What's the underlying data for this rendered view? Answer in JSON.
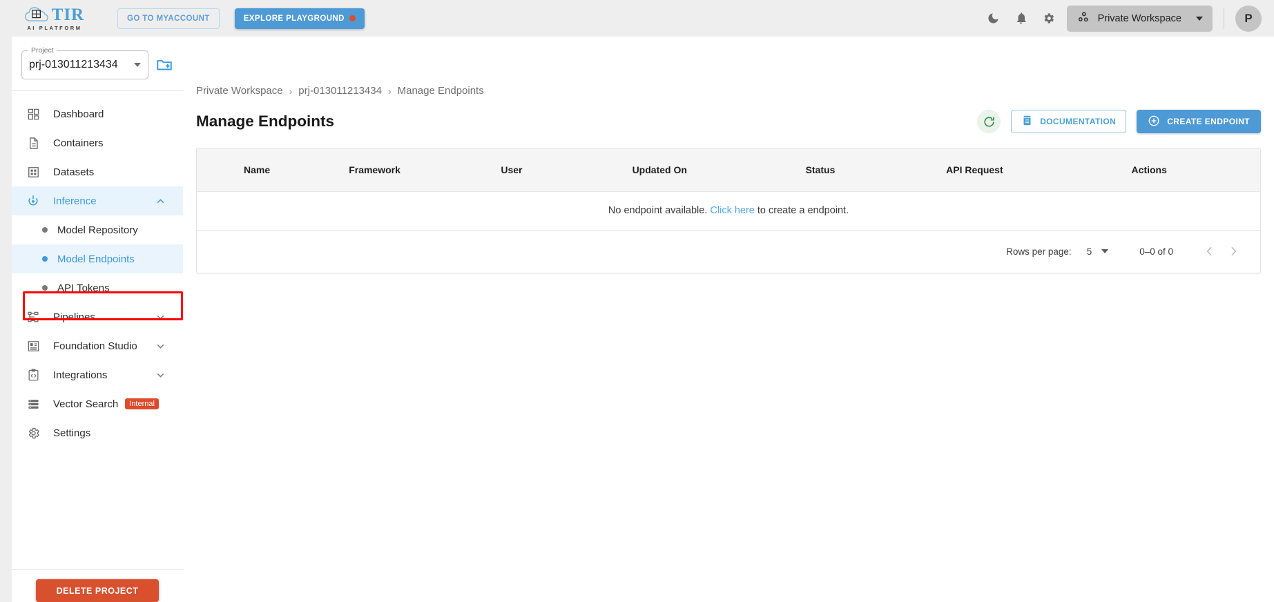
{
  "topbar": {
    "logo_text": "TIR",
    "logo_sub": "AI PLATFORM",
    "myaccount_label": "GO TO MYACCOUNT",
    "playground_label": "EXPLORE PLAYGROUND",
    "icons": [
      "dark-mode-icon",
      "notifications-icon",
      "settings-icon"
    ],
    "workspace_label": "Private Workspace",
    "avatar_initial": "P"
  },
  "sidebar": {
    "project_legend": "Project",
    "project_value": "prj-013011213434",
    "items": [
      {
        "label": "Dashboard",
        "icon": "dashboard-icon"
      },
      {
        "label": "Containers",
        "icon": "container-icon"
      },
      {
        "label": "Datasets",
        "icon": "dataset-icon"
      },
      {
        "label": "Inference",
        "icon": "inference-icon",
        "expanded": true
      }
    ],
    "inference_children": [
      {
        "label": "Model Repository"
      },
      {
        "label": "Model Endpoints",
        "selected": true
      },
      {
        "label": "API Tokens"
      }
    ],
    "items_after": [
      {
        "label": "Pipelines",
        "icon": "pipelines-icon",
        "collapsed": true
      },
      {
        "label": "Foundation Studio",
        "icon": "foundation-studio-icon",
        "collapsed": true
      },
      {
        "label": "Integrations",
        "icon": "integrations-icon",
        "collapsed": true
      },
      {
        "label": "Vector Search",
        "icon": "vector-search-icon",
        "badge": "Internal"
      },
      {
        "label": "Settings",
        "icon": "settings-gear-icon"
      }
    ],
    "delete_label": "DELETE PROJECT"
  },
  "main": {
    "breadcrumb": [
      "Private Workspace",
      "prj-013011213434",
      "Manage Endpoints"
    ],
    "breadcrumb_sep": "›",
    "page_title": "Manage Endpoints",
    "documentation_label": "DOCUMENTATION",
    "create_label": "CREATE ENDPOINT",
    "table": {
      "columns": [
        "Name",
        "Framework",
        "User",
        "Updated On",
        "Status",
        "API Request",
        "Actions"
      ],
      "rows": [],
      "empty_prefix": "No endpoint available.",
      "empty_link": "Click here",
      "empty_suffix": "to create a endpoint."
    },
    "pagination": {
      "rows_per_page_label": "Rows per page:",
      "rows_per_page_value": "5",
      "range": "0–0 of 0"
    }
  },
  "colors": {
    "accent_blue": "#4e9ad6",
    "danger_red": "#d9502e",
    "highlight_red": "#ff0000",
    "selected_bg": "#eaf4fc"
  }
}
